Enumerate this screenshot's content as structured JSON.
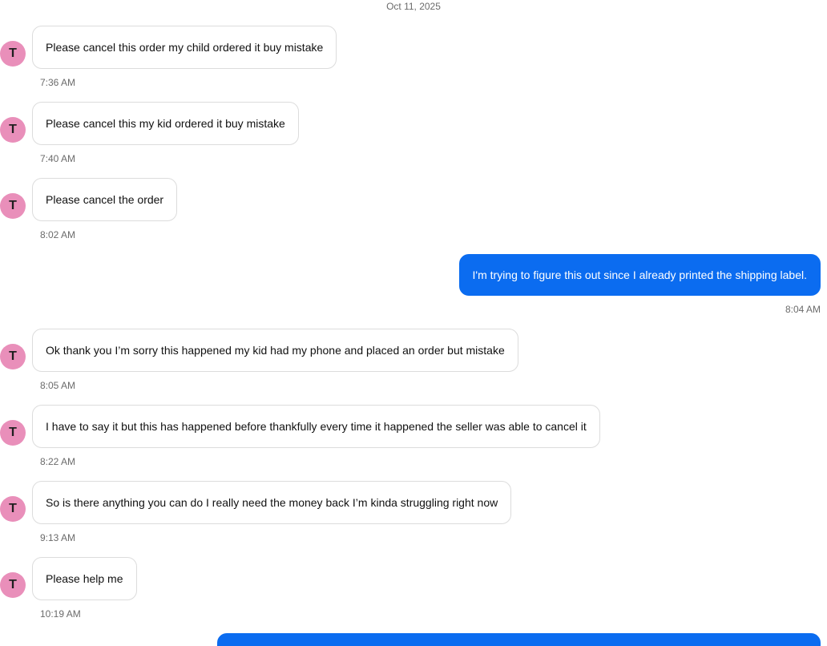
{
  "conversation": {
    "date_separator": "Oct 11, 2025",
    "messages": [
      {
        "direction": "in",
        "avatar": "T",
        "text": "Please cancel this order my child ordered it buy mistake",
        "time": "7:36 AM"
      },
      {
        "direction": "in",
        "avatar": "T",
        "text": "Please cancel this my kid ordered it buy mistake",
        "time": "7:40 AM"
      },
      {
        "direction": "in",
        "avatar": "T",
        "text": "Please cancel the order",
        "time": "8:02 AM"
      },
      {
        "direction": "out",
        "text": "I'm trying to figure this out since I already printed the shipping label.",
        "time": "8:04 AM"
      },
      {
        "direction": "in",
        "avatar": "T",
        "text": "Ok thank you I’m sorry this happened my kid had my phone and placed an order but mistake",
        "time": "8:05 AM"
      },
      {
        "direction": "in",
        "avatar": "T",
        "text": "I have to say it but this has happened before thankfully every time it happened the seller was able to cancel it",
        "time": "8:22 AM"
      },
      {
        "direction": "in",
        "avatar": "T",
        "text": "So is there anything you can do I really need the money back I’m kinda struggling right now",
        "time": "9:13 AM"
      },
      {
        "direction": "in",
        "avatar": "T",
        "text": "Please help me",
        "time": "10:19 AM"
      },
      {
        "direction": "out",
        "text": "",
        "time": ""
      }
    ]
  },
  "colors": {
    "avatar_bg": "#e98fba",
    "outgoing_bubble": "#0b6cf0",
    "incoming_border": "#dcdcdc",
    "meta_text": "#6b6b6b"
  }
}
